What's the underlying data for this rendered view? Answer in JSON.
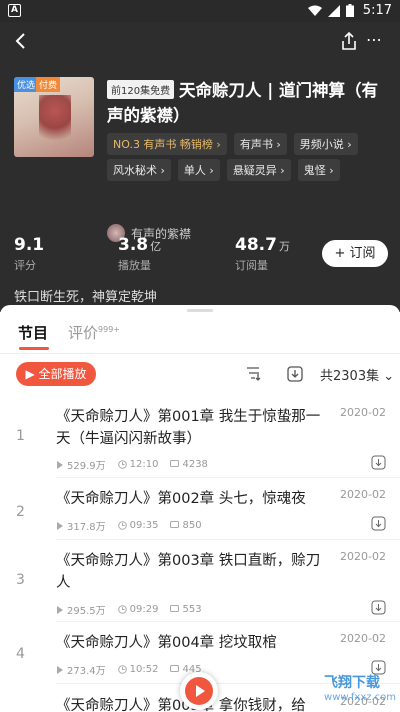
{
  "status_bar": {
    "notif": "A",
    "time": "5:17"
  },
  "book": {
    "episode_badge": "前120集免费",
    "title": "天命赊刀人 | 道门神算（有声的紫襟）",
    "cover_badges": [
      "优选",
      "付费"
    ],
    "tags": [
      [
        "NO.3 有声书 畅销榜 ›",
        "有声书 ›",
        "男频小说 ›"
      ],
      [
        "风水秘术 ›",
        "单人 ›",
        "悬疑灵异 ›",
        "鬼怪 ›"
      ]
    ],
    "author": "有声的紫襟",
    "stats": [
      {
        "num": "9.1",
        "unit": "",
        "label": "评分"
      },
      {
        "num": "3.8",
        "unit": "亿",
        "label": "播放量"
      },
      {
        "num": "48.7",
        "unit": "万",
        "label": "订阅量"
      }
    ],
    "subscribe_label": "+ 订阅",
    "slogan": "铁口断生死，神算定乾坤"
  },
  "tabs": {
    "active": "节目",
    "inactive": "评价",
    "inactive_count": "999+"
  },
  "toolbar": {
    "play_all": "▶ 全部播放",
    "total": "共2303集 ⌄"
  },
  "episodes": [
    {
      "idx": "1",
      "title": "《天命赊刀人》第001章 我生于惊蛰那一天（牛逼闪闪新故事）",
      "date": "2020-02",
      "plays": "529.9万",
      "duration": "12:10",
      "comments": "4238"
    },
    {
      "idx": "2",
      "title": "《天命赊刀人》第002章 头七，惊魂夜",
      "date": "2020-02",
      "plays": "317.8万",
      "duration": "09:35",
      "comments": "850"
    },
    {
      "idx": "3",
      "title": "《天命赊刀人》第003章 铁口直断，赊刀人",
      "date": "2020-02",
      "plays": "295.5万",
      "duration": "09:29",
      "comments": "553"
    },
    {
      "idx": "4",
      "title": "《天命赊刀人》第004章 挖坟取棺",
      "date": "2020-02",
      "plays": "273.4万",
      "duration": "10:52",
      "comments": "445"
    },
    {
      "idx": "5",
      "title": "《天命赊刀人》第005章 拿你钱财，给",
      "date": "2020-02",
      "plays": "",
      "duration": "",
      "comments": ""
    }
  ],
  "watermark": {
    "line1": "飞翔下载",
    "line2": "www.fxxz.com"
  }
}
